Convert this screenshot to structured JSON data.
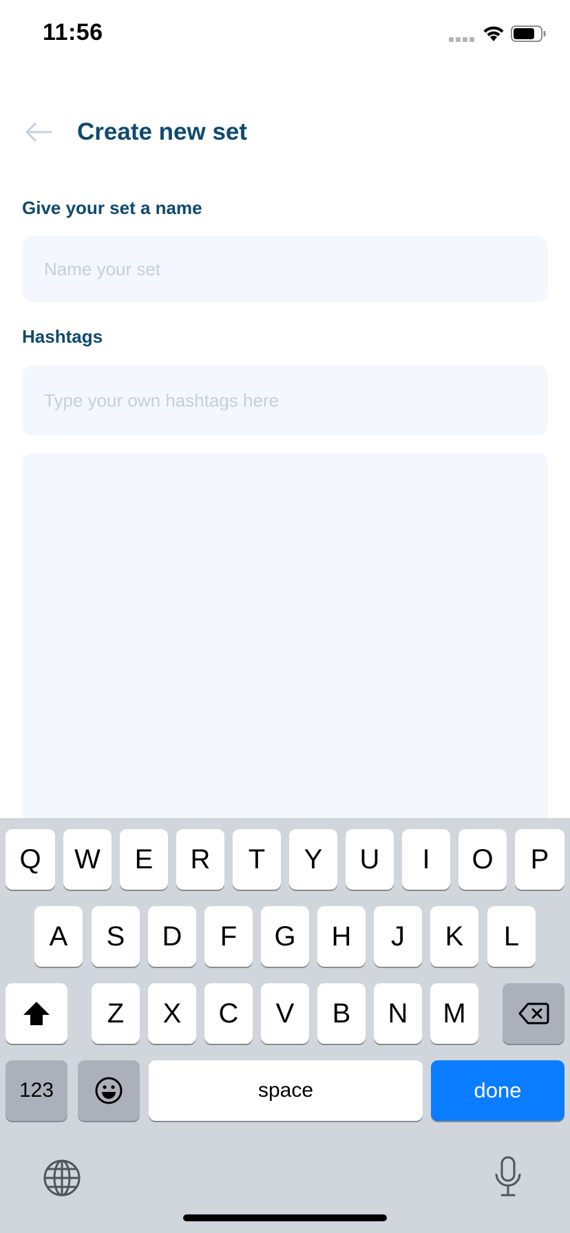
{
  "status_bar": {
    "time": "11:56"
  },
  "header": {
    "title": "Create new set",
    "back_icon": "arrow-left-icon"
  },
  "form": {
    "name_label": "Give your set a name",
    "name_placeholder": "Name your set",
    "name_value": "",
    "hashtags_label": "Hashtags",
    "hashtags_placeholder": "Type your own hashtags here",
    "hashtags_value": ""
  },
  "keyboard": {
    "row1": [
      "Q",
      "W",
      "E",
      "R",
      "T",
      "Y",
      "U",
      "I",
      "O",
      "P"
    ],
    "row2": [
      "A",
      "S",
      "D",
      "F",
      "G",
      "H",
      "J",
      "K",
      "L"
    ],
    "row3": [
      "Z",
      "X",
      "C",
      "V",
      "B",
      "N",
      "M"
    ],
    "numbers_label": "123",
    "space_label": "space",
    "done_label": "done",
    "shift_icon": "shift-icon",
    "backspace_icon": "backspace-icon",
    "emoji_icon": "emoji-icon",
    "globe_icon": "globe-icon",
    "mic_icon": "microphone-icon"
  },
  "colors": {
    "title": "#0e4a6e",
    "input_bg": "#f4f7fe",
    "placeholder": "#c3cfe0",
    "keyboard_bg": "#d1d5dc",
    "done_key": "#0a7cff"
  }
}
